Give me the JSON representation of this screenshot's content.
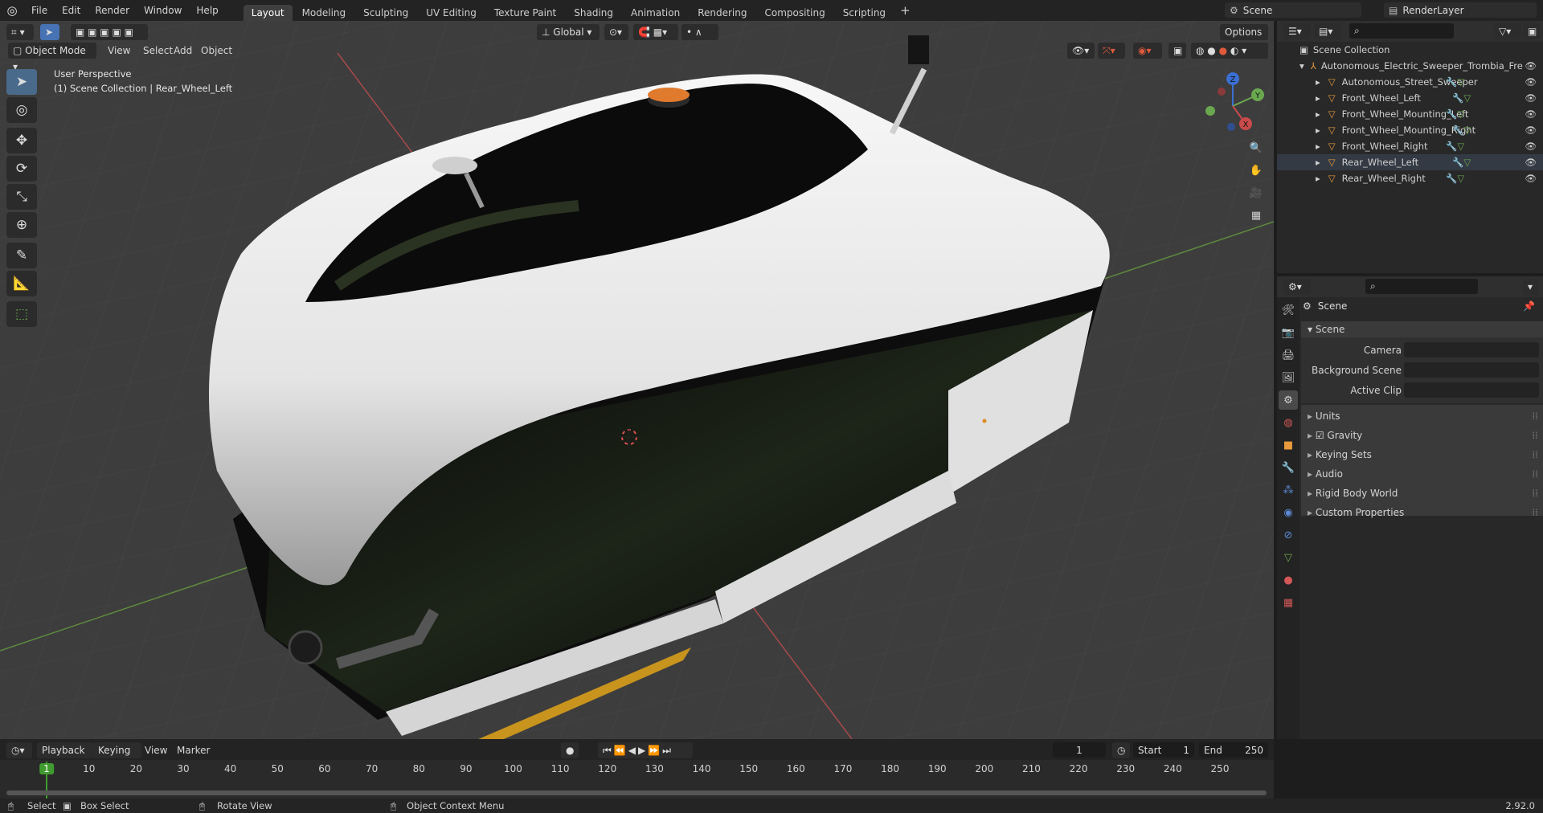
{
  "topbar": {
    "menus": [
      "File",
      "Edit",
      "Render",
      "Window",
      "Help"
    ],
    "workspaces": [
      "Layout",
      "Modeling",
      "Sculpting",
      "UV Editing",
      "Texture Paint",
      "Shading",
      "Animation",
      "Rendering",
      "Compositing",
      "Scripting"
    ],
    "active_workspace": "Layout",
    "add_tab": "+",
    "scene_name": "Scene",
    "view_layer": "RenderLayer"
  },
  "viewport": {
    "mode": "Object Mode",
    "menus": [
      "View",
      "Select",
      "Add",
      "Object"
    ],
    "orientation": "Global",
    "options_label": "Options",
    "info_line1": "User Perspective",
    "info_line2": "(1) Scene Collection | Rear_Wheel_Left",
    "gizmo_x": "X",
    "gizmo_y": "Y",
    "gizmo_z": "Z"
  },
  "outliner": {
    "root": "Scene Collection",
    "collection": "Autonomous_Electric_Sweeper_Trombia_Fre",
    "items": [
      "Autonomous_Street_Sweeper",
      "Front_Wheel_Left",
      "Front_Wheel_Mounting_Left",
      "Front_Wheel_Mounting_Right",
      "Front_Wheel_Right",
      "Rear_Wheel_Left",
      "Rear_Wheel_Right"
    ],
    "selected_item": "Rear_Wheel_Left"
  },
  "properties": {
    "context": "Scene",
    "panel": "Scene",
    "fields": [
      {
        "label": "Camera",
        "value": ""
      },
      {
        "label": "Background Scene",
        "value": ""
      },
      {
        "label": "Active Clip",
        "value": ""
      }
    ],
    "subpanels": [
      "Units",
      "Gravity",
      "Keying Sets",
      "Audio",
      "Rigid Body World",
      "Custom Properties"
    ],
    "gravity_checked": true
  },
  "timeline": {
    "menus": [
      "Playback",
      "Keying",
      "View",
      "Marker"
    ],
    "current_frame": "1",
    "start_label": "Start",
    "start_value": "1",
    "end_label": "End",
    "end_value": "250",
    "ticks": [
      "1",
      "10",
      "20",
      "30",
      "40",
      "50",
      "60",
      "70",
      "80",
      "90",
      "100",
      "110",
      "120",
      "130",
      "140",
      "150",
      "160",
      "170",
      "180",
      "190",
      "200",
      "210",
      "220",
      "230",
      "240",
      "250"
    ]
  },
  "statusbar": {
    "select": "Select",
    "box_select": "Box Select",
    "rotate_view": "Rotate View",
    "context_menu": "Object Context Menu",
    "version": "2.92.0"
  },
  "colors": {
    "accent": "#4772b3",
    "viewport_bg": "#3d3d3d",
    "axis_x": "#c94a4a",
    "axis_y": "#6aa84f",
    "axis_z": "#3b6fd1",
    "current_frame": "#3f9b2f",
    "object_icon": "#e89b3c"
  }
}
